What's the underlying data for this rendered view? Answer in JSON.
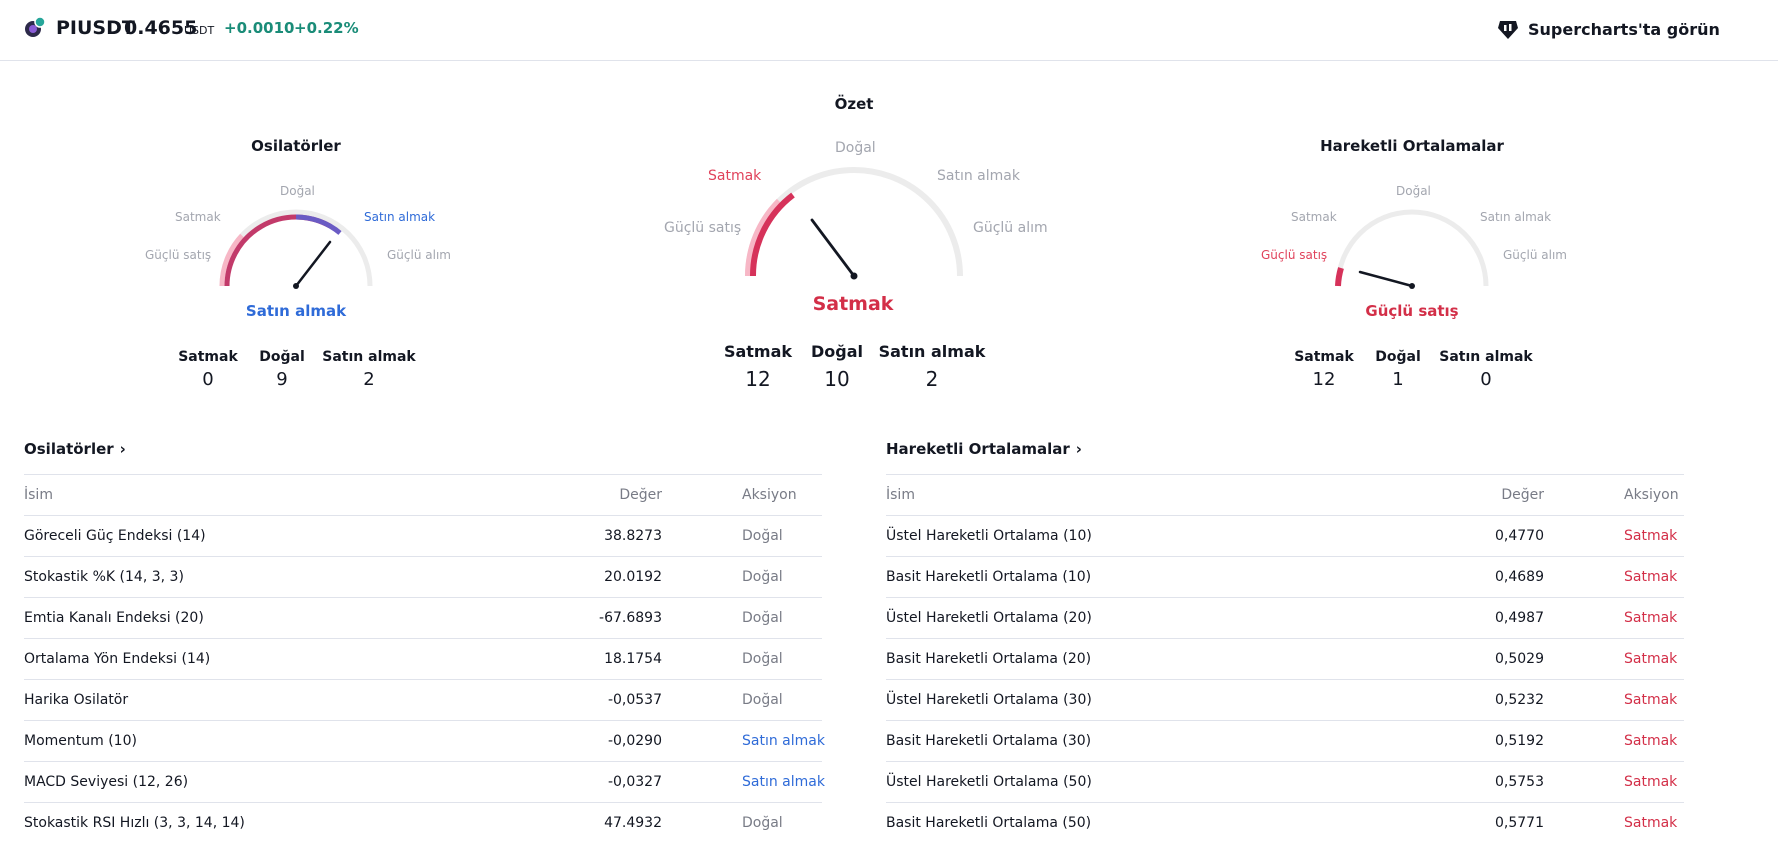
{
  "header": {
    "symbol": "PIUSDT",
    "price": "0.4655",
    "currency": "USDT",
    "change_abs": "+0.0010",
    "change_pct": "+0.22%",
    "supercharts_label": "Supercharts'ta görün"
  },
  "gauges": {
    "oscillators": {
      "title": "Osilatörler",
      "labels": {
        "strong_sell": "Güçlü satış",
        "sell": "Satmak",
        "neutral": "Doğal",
        "buy": "Satın almak",
        "strong_buy": "Güçlü alım"
      },
      "result": "Satın almak",
      "counts": {
        "sell_label": "Satmak",
        "sell": "0",
        "neutral_label": "Doğal",
        "neutral": "9",
        "buy_label": "Satın almak",
        "buy": "2"
      }
    },
    "summary": {
      "title": "Özet",
      "labels": {
        "strong_sell": "Güçlü satış",
        "sell": "Satmak",
        "neutral": "Doğal",
        "buy": "Satın almak",
        "strong_buy": "Güçlü alım"
      },
      "result": "Satmak",
      "counts": {
        "sell_label": "Satmak",
        "sell": "12",
        "neutral_label": "Doğal",
        "neutral": "10",
        "buy_label": "Satın almak",
        "buy": "2"
      }
    },
    "moving_averages": {
      "title": "Hareketli Ortalamalar",
      "labels": {
        "strong_sell": "Güçlü satış",
        "sell": "Satmak",
        "neutral": "Doğal",
        "buy": "Satın almak",
        "strong_buy": "Güçlü alım"
      },
      "result": "Güçlü satış",
      "counts": {
        "sell_label": "Satmak",
        "sell": "12",
        "neutral_label": "Doğal",
        "neutral": "1",
        "buy_label": "Satın almak",
        "buy": "0"
      }
    }
  },
  "tables": {
    "oscillators": {
      "title": "Osilatörler",
      "columns": {
        "name": "İsim",
        "value": "Değer",
        "action": "Aksiyon"
      },
      "rows": [
        {
          "name": "Göreceli Güç Endeksi (14)",
          "value": "38.8273",
          "action": "Doğal",
          "type": "neutral"
        },
        {
          "name": "Stokastik %K (14, 3, 3)",
          "value": "20.0192",
          "action": "Doğal",
          "type": "neutral"
        },
        {
          "name": "Emtia Kanalı Endeksi (20)",
          "value": "-67.6893",
          "action": "Doğal",
          "type": "neutral"
        },
        {
          "name": "Ortalama Yön Endeksi (14)",
          "value": "18.1754",
          "action": "Doğal",
          "type": "neutral"
        },
        {
          "name": "Harika Osilatör",
          "value": "-0,0537",
          "action": "Doğal",
          "type": "neutral"
        },
        {
          "name": "Momentum (10)",
          "value": "-0,0290",
          "action": "Satın almak",
          "type": "buy"
        },
        {
          "name": "MACD Seviyesi (12, 26)",
          "value": "-0,0327",
          "action": "Satın almak",
          "type": "buy"
        },
        {
          "name": "Stokastik RSI Hızlı (3, 3, 14, 14)",
          "value": "47.4932",
          "action": "Doğal",
          "type": "neutral"
        }
      ]
    },
    "moving_averages": {
      "title": "Hareketli Ortalamalar",
      "columns": {
        "name": "İsim",
        "value": "Değer",
        "action": "Aksiyon"
      },
      "rows": [
        {
          "name": "Üstel Hareketli Ortalama (10)",
          "value": "0,4770",
          "action": "Satmak",
          "type": "sell"
        },
        {
          "name": "Basit Hareketli Ortalama (10)",
          "value": "0,4689",
          "action": "Satmak",
          "type": "sell"
        },
        {
          "name": "Üstel Hareketli Ortalama (20)",
          "value": "0,4987",
          "action": "Satmak",
          "type": "sell"
        },
        {
          "name": "Basit Hareketli Ortalama (20)",
          "value": "0,5029",
          "action": "Satmak",
          "type": "sell"
        },
        {
          "name": "Üstel Hareketli Ortalama (30)",
          "value": "0,5232",
          "action": "Satmak",
          "type": "sell"
        },
        {
          "name": "Basit Hareketli Ortalama (30)",
          "value": "0,5192",
          "action": "Satmak",
          "type": "sell"
        },
        {
          "name": "Üstel Hareketli Ortalama (50)",
          "value": "0,5753",
          "action": "Satmak",
          "type": "sell"
        },
        {
          "name": "Basit Hareketli Ortalama (50)",
          "value": "0,5771",
          "action": "Satmak",
          "type": "sell"
        }
      ]
    }
  },
  "colors": {
    "sell": "#d32f48",
    "buy": "#2f6bd8",
    "neutral": "#787b86",
    "positive": "#1a8c78"
  }
}
